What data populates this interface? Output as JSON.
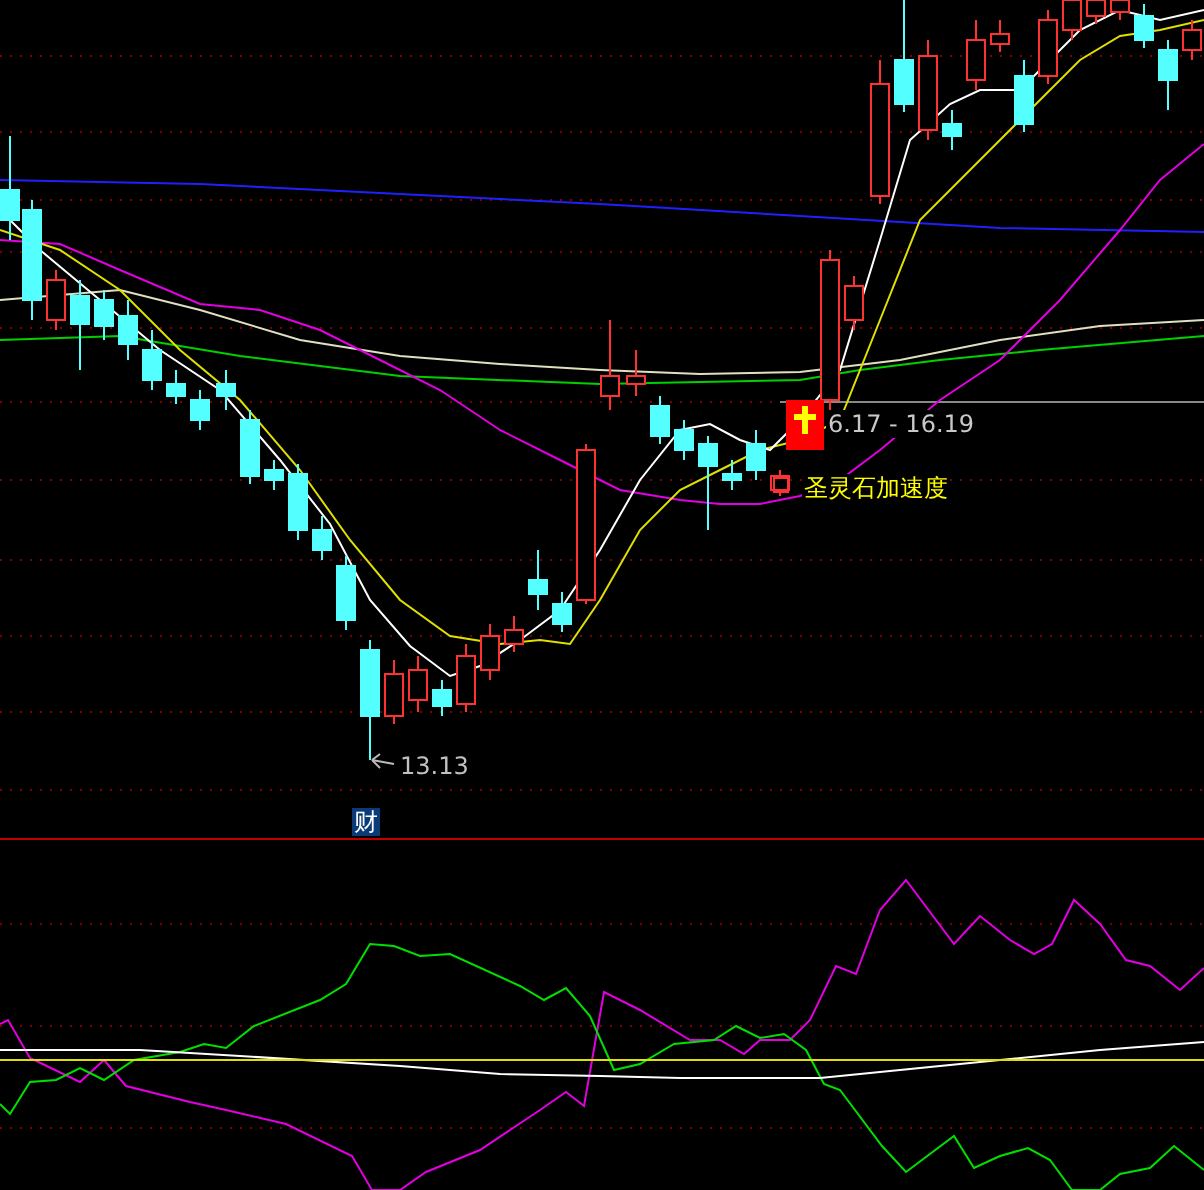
{
  "price_panel": {
    "range_label": "6.17 - 16.19",
    "indicator_label": "圣灵石加速度",
    "low_label": "13.13"
  },
  "indicator_panel": {
    "marker_label": "财"
  }
}
